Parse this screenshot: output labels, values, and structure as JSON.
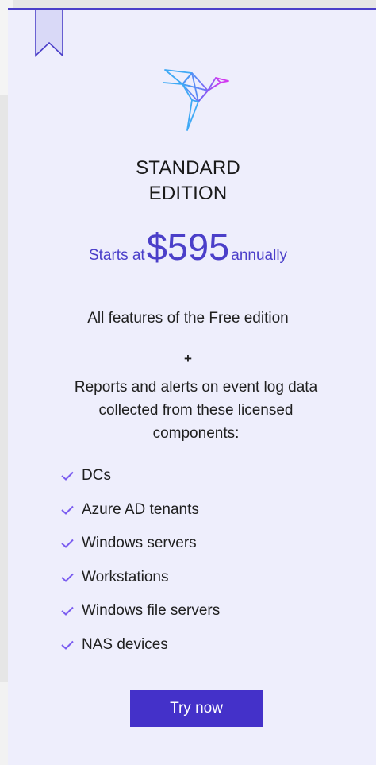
{
  "card": {
    "title_line1": "STANDARD",
    "title_line2": "EDITION",
    "price": {
      "prefix": "Starts at",
      "amount": "$595",
      "suffix": "annually"
    },
    "features_heading": "All features of the Free edition",
    "plus_sign": "+",
    "description": "Reports and alerts on event log data collected from these licensed components:",
    "components": [
      "DCs",
      "Azure AD tenants",
      "Windows servers",
      "Workstations",
      "Windows file servers",
      "NAS devices"
    ],
    "cta_label": "Try now",
    "icons": {
      "logo": "origami-bird-logo",
      "bookmark": "bookmark-ribbon-icon",
      "bullet": "checkmark-icon"
    }
  },
  "colors": {
    "accent": "#4b3fc9",
    "button": "#4431c9",
    "card_background": "#eeeefc",
    "check": "#7a5cf0",
    "text": "#1f1f1f"
  }
}
